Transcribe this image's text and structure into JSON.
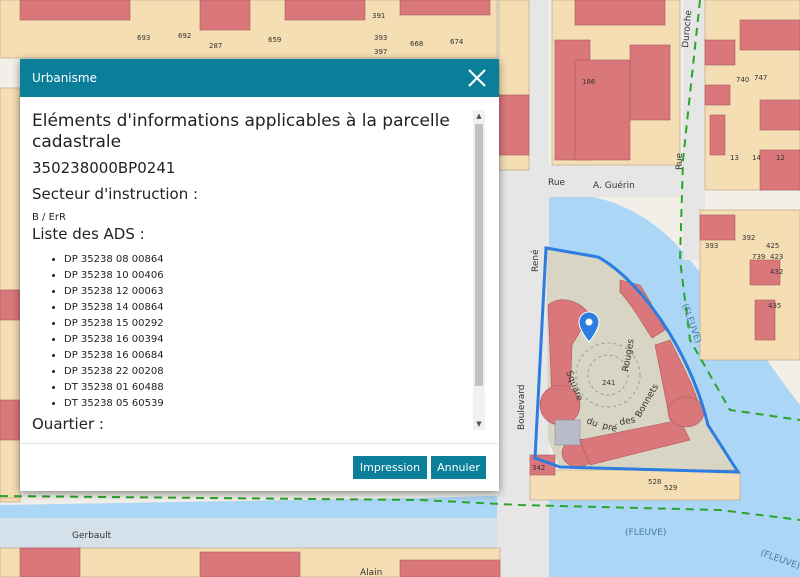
{
  "map": {
    "colors": {
      "background": "#f2efe9",
      "building": "#d9777a",
      "parcel": "#f5deb3",
      "water": "#abd6f5",
      "road": "#e6e6e6",
      "selection": "#2b7de0",
      "boundary": "#2aa52a"
    },
    "street_labels": {
      "rue": "Rue",
      "guerin": "A. Guérin",
      "rene": "René",
      "boulevard": "Boulevard",
      "square": "Square",
      "du": "du",
      "pre": "pré",
      "des": "des",
      "bonnets": "Bonnets",
      "rouges": "Rouges",
      "gerbault": "Gerbault",
      "alain": "Alain",
      "rue_right": "Rue",
      "duroche": "Duroche",
      "fleuve1": "(FLEUVE)",
      "fleuve2": "(FLEUVE)",
      "fleuve3": "(FLEUVE)"
    },
    "parcel_numbers": {
      "n693": "693",
      "n692": "692",
      "n287": "287",
      "n659": "659",
      "n391": "391",
      "n393a": "393",
      "n397": "397",
      "n668": "668",
      "n674": "674",
      "n186": "186",
      "n241": "241",
      "n528": "528",
      "n529": "529",
      "n342": "342",
      "n393b": "393",
      "n392": "392",
      "n425": "425",
      "n739": "739",
      "n423": "423",
      "n432": "432",
      "n435": "435",
      "n747": "747",
      "n13": "13",
      "n14": "14",
      "n12": "12",
      "n740": "740"
    },
    "marker_icon": "map-pin-icon"
  },
  "dialog": {
    "title": "Urbanisme",
    "close_icon": "close-icon",
    "heading": "Eléments d'informations applicables à la parcelle cadastrale",
    "parcel_id": "350238000BP0241",
    "secteur_title": "Secteur d'instruction :",
    "secteur_value": "B / ErR",
    "ads_title": "Liste des ADS :",
    "ads_items": [
      "DP 35238 08 00864",
      "DP 35238 10 00406",
      "DP 35238 12 00063",
      "DP 35238 14 00864",
      "DP 35238 15 00292",
      "DP 35238 16 00394",
      "DP 35238 16 00684",
      "DP 35238 22 00208",
      "DT 35238 01 60488",
      "DT 35238 05 60539"
    ],
    "quartier_title": "Quartier :",
    "buttons": {
      "print": "Impression",
      "cancel": "Annuler"
    },
    "colors": {
      "header": "#0b7e99",
      "button": "#0b7e99"
    }
  }
}
